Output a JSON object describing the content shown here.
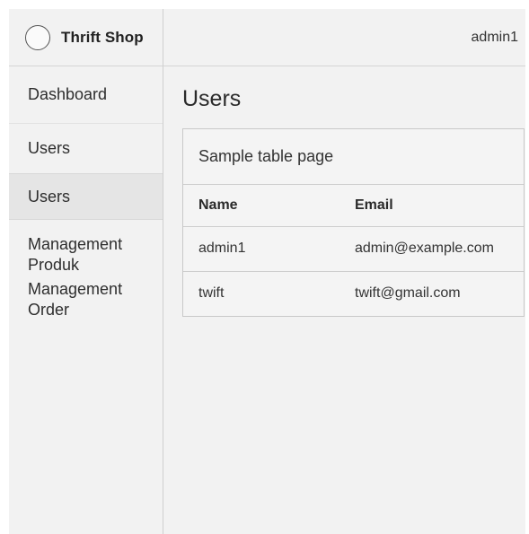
{
  "app": {
    "brand": "Thrift Shop"
  },
  "header": {
    "user": "admin1"
  },
  "sidebar": {
    "items": [
      {
        "label": "Dashboard"
      },
      {
        "label": "Users"
      },
      {
        "label": "Users",
        "active": true
      },
      {
        "label": "Management Produk"
      },
      {
        "label": "Management Order"
      }
    ]
  },
  "main": {
    "title": "Users",
    "card": {
      "title": "Sample table page",
      "columns": [
        "Name",
        "Email"
      ],
      "rows": [
        [
          "admin1",
          "admin@example.com"
        ],
        [
          "twift",
          "twift@gmail.com"
        ]
      ]
    }
  },
  "colors": {
    "background": "#f2f2f2",
    "active_item": "#e5e5e5",
    "border": "#cfcfcf"
  }
}
